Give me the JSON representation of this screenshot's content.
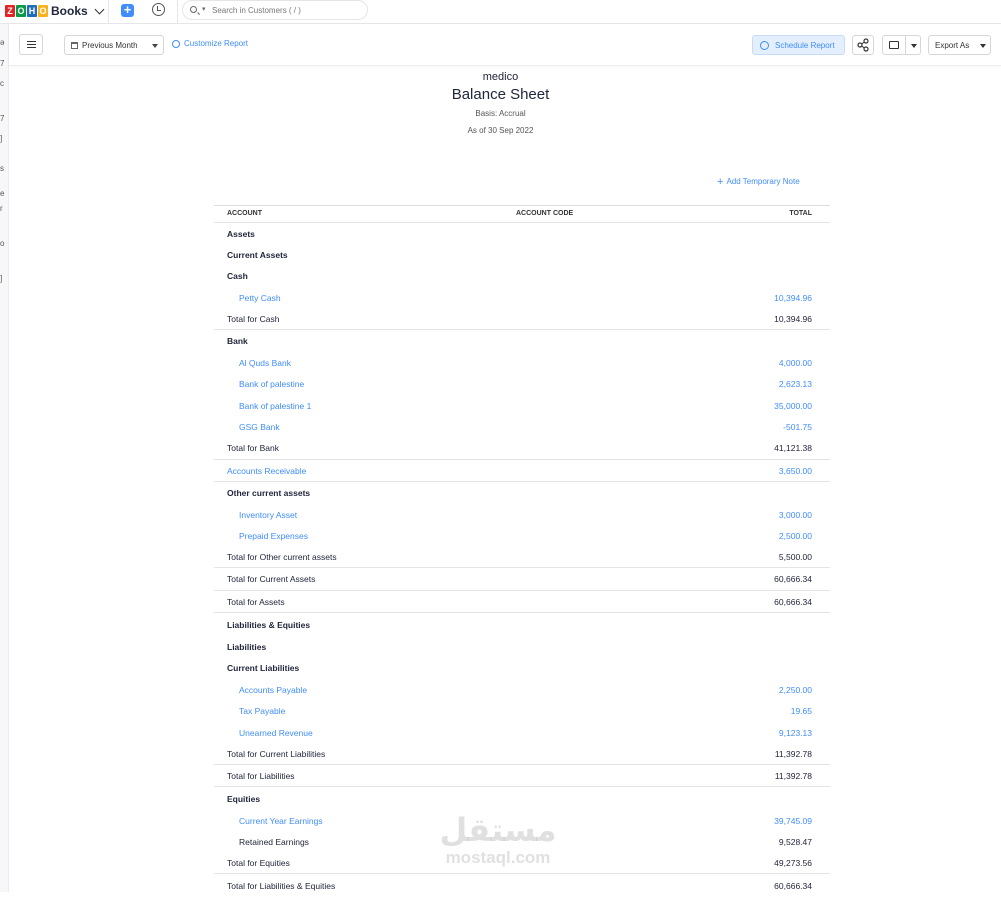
{
  "app": {
    "brand_letters": [
      "Z",
      "O",
      "H",
      "O"
    ],
    "brand_name": "Books"
  },
  "topbar": {
    "search_placeholder": "Search in Customers ( / )"
  },
  "toolbar": {
    "period": "Previous Month",
    "customize": "Customize Report",
    "schedule": "Schedule Report",
    "export": "Export As"
  },
  "report": {
    "company": "medico",
    "title": "Balance Sheet",
    "basis": "Basis: Accrual",
    "as_of": "As of 30 Sep 2022",
    "add_note": "Add Temporary Note",
    "columns": {
      "account": "ACCOUNT",
      "code": "ACCOUNT CODE",
      "total": "TOTAL"
    },
    "rows": [
      {
        "label": "Assets",
        "value": "",
        "kind": "heading",
        "indent": 0
      },
      {
        "label": "Current Assets",
        "value": "",
        "kind": "heading",
        "indent": 0
      },
      {
        "label": "Cash",
        "value": "",
        "kind": "heading",
        "indent": 0
      },
      {
        "label": "Petty Cash",
        "value": "10,394.96",
        "kind": "account",
        "indent": 1
      },
      {
        "label": "Total for Cash",
        "value": "10,394.96",
        "kind": "total",
        "indent": 0
      },
      {
        "label": "Bank",
        "value": "",
        "kind": "heading",
        "indent": 0
      },
      {
        "label": "Al Quds Bank",
        "value": "4,000.00",
        "kind": "account",
        "indent": 1
      },
      {
        "label": "Bank of palestine",
        "value": "2,623.13",
        "kind": "account",
        "indent": 1
      },
      {
        "label": "Bank of palestine 1",
        "value": "35,000.00",
        "kind": "account",
        "indent": 1
      },
      {
        "label": "GSG Bank",
        "value": "-501.75",
        "kind": "account",
        "indent": 1
      },
      {
        "label": "Total for Bank",
        "value": "41,121.38",
        "kind": "total",
        "indent": 0
      },
      {
        "label": "Accounts Receivable",
        "value": "3,650.00",
        "kind": "account",
        "indent": 0
      },
      {
        "label": "Other current assets",
        "value": "",
        "kind": "heading",
        "indent": 0
      },
      {
        "label": "Inventory Asset",
        "value": "3,000.00",
        "kind": "account",
        "indent": 1
      },
      {
        "label": "Prepaid Expenses",
        "value": "2,500.00",
        "kind": "account",
        "indent": 1
      },
      {
        "label": "Total for Other current assets",
        "value": "5,500.00",
        "kind": "total",
        "indent": 0
      },
      {
        "label": "Total for Current Assets",
        "value": "60,666.34",
        "kind": "total",
        "indent": 0
      },
      {
        "label": "Total for Assets",
        "value": "60,666.34",
        "kind": "total",
        "indent": 0
      },
      {
        "label": "Liabilities & Equities",
        "value": "",
        "kind": "heading",
        "indent": 0
      },
      {
        "label": "Liabilities",
        "value": "",
        "kind": "heading",
        "indent": 0
      },
      {
        "label": "Current Liabilities",
        "value": "",
        "kind": "heading",
        "indent": 0
      },
      {
        "label": "Accounts Payable",
        "value": "2,250.00",
        "kind": "account",
        "indent": 1
      },
      {
        "label": "Tax Payable",
        "value": "19.65",
        "kind": "account",
        "indent": 1
      },
      {
        "label": "Unearned Revenue",
        "value": "9,123.13",
        "kind": "account",
        "indent": 1
      },
      {
        "label": "Total for Current Liabilities",
        "value": "11,392.78",
        "kind": "total",
        "indent": 0
      },
      {
        "label": "Total for Liabilities",
        "value": "11,392.78",
        "kind": "total",
        "indent": 0
      },
      {
        "label": "Equities",
        "value": "",
        "kind": "heading",
        "indent": 0
      },
      {
        "label": "Current Year Earnings",
        "value": "39,745.09",
        "kind": "account",
        "indent": 1
      },
      {
        "label": "Retained Earnings",
        "value": "9,528.47",
        "kind": "plain",
        "indent": 1
      },
      {
        "label": "Total for Equities",
        "value": "49,273.56",
        "kind": "total",
        "indent": 0
      },
      {
        "label": "Total for Liabilities & Equities",
        "value": "60,666.34",
        "kind": "total",
        "indent": 0
      }
    ]
  },
  "watermark": {
    "arabic": "مستقل",
    "latin": "mostaql.com"
  }
}
